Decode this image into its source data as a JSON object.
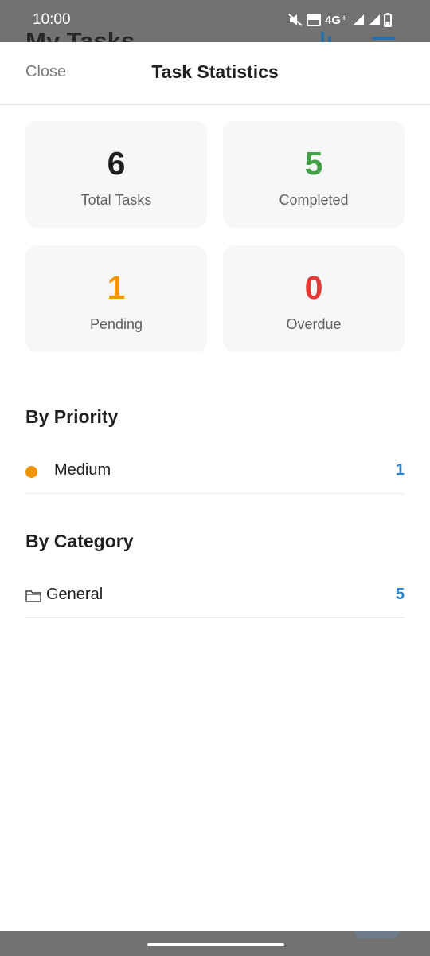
{
  "status_bar": {
    "time": "10:00",
    "network": "4G⁺",
    "behind_title": "My Tasks"
  },
  "header": {
    "close_label": "Close",
    "title": "Task Statistics"
  },
  "stats": [
    {
      "value": "6",
      "label": "Total Tasks",
      "color": "#1f1f1f"
    },
    {
      "value": "5",
      "label": "Completed",
      "color": "#43a047"
    },
    {
      "value": "1",
      "label": "Pending",
      "color": "#f29500"
    },
    {
      "value": "0",
      "label": "Overdue",
      "color": "#e53935"
    }
  ],
  "priority": {
    "title": "By Priority",
    "items": [
      {
        "label": "Medium",
        "count": "1",
        "color": "#f29500"
      }
    ]
  },
  "category": {
    "title": "By Category",
    "items": [
      {
        "label": "General",
        "count": "5",
        "icon": "folder-icon"
      }
    ]
  }
}
